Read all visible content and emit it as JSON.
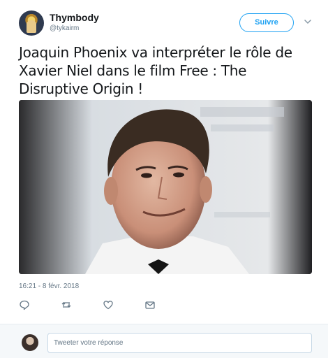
{
  "author": {
    "name": "Thymbody",
    "handle": "@tykairm"
  },
  "follow_button": {
    "label": "Suivre"
  },
  "tweet": {
    "text": "Joaquin Phoenix va interpréter le rôle de Xavier Niel dans le film Free : The Disruptive Origin !",
    "timestamp": "16:21 - 8 févr. 2018"
  },
  "icons": {
    "caret": "chevron-down-icon",
    "reply": "reply-icon",
    "retweet": "retweet-icon",
    "like": "heart-icon",
    "message": "envelope-icon"
  },
  "reply": {
    "placeholder": "Tweeter votre réponse"
  },
  "colors": {
    "accent": "#1da1f2",
    "muted": "#657786",
    "text": "#14171a"
  }
}
